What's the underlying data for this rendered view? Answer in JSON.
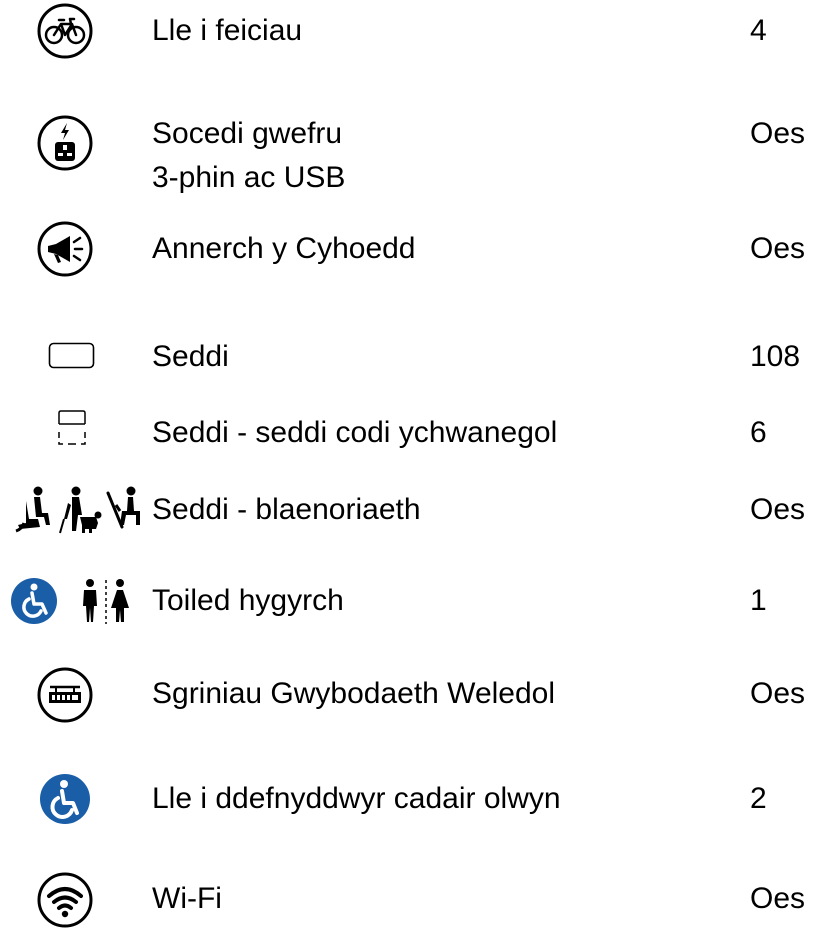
{
  "colors": {
    "text": "#000000",
    "accent_blue": "#1a5ea8",
    "background": "#ffffff"
  },
  "amenities": [
    {
      "icon": "bicycle-icon",
      "label": "Lle i feiciau",
      "value": "4"
    },
    {
      "icon": "power-socket-icon",
      "label_line1": "Socedi gwefru",
      "label_line2": "3-phin ac USB",
      "value": "Oes"
    },
    {
      "icon": "megaphone-icon",
      "label": "Annerch y Cyhoedd",
      "value": "Oes"
    },
    {
      "icon": "seat-icon",
      "label": "Seddi",
      "value": "108"
    },
    {
      "icon": "folding-seat-icon",
      "label": "Seddi - seddi codi ychwanegol",
      "value": "6"
    },
    {
      "icon": "priority-seating-icon",
      "label": "Seddi - blaenoriaeth",
      "value": "Oes"
    },
    {
      "icon": "accessible-toilet-icon",
      "label": "Toiled hygyrch",
      "value": "1"
    },
    {
      "icon": "information-screen-icon",
      "label": "Sgriniau Gwybodaeth Weledol",
      "value": "Oes"
    },
    {
      "icon": "wheelchair-icon",
      "label": "Lle i ddefnyddwyr cadair olwyn",
      "value": "2"
    },
    {
      "icon": "wifi-icon",
      "label": "Wi-Fi",
      "value": "Oes"
    }
  ]
}
